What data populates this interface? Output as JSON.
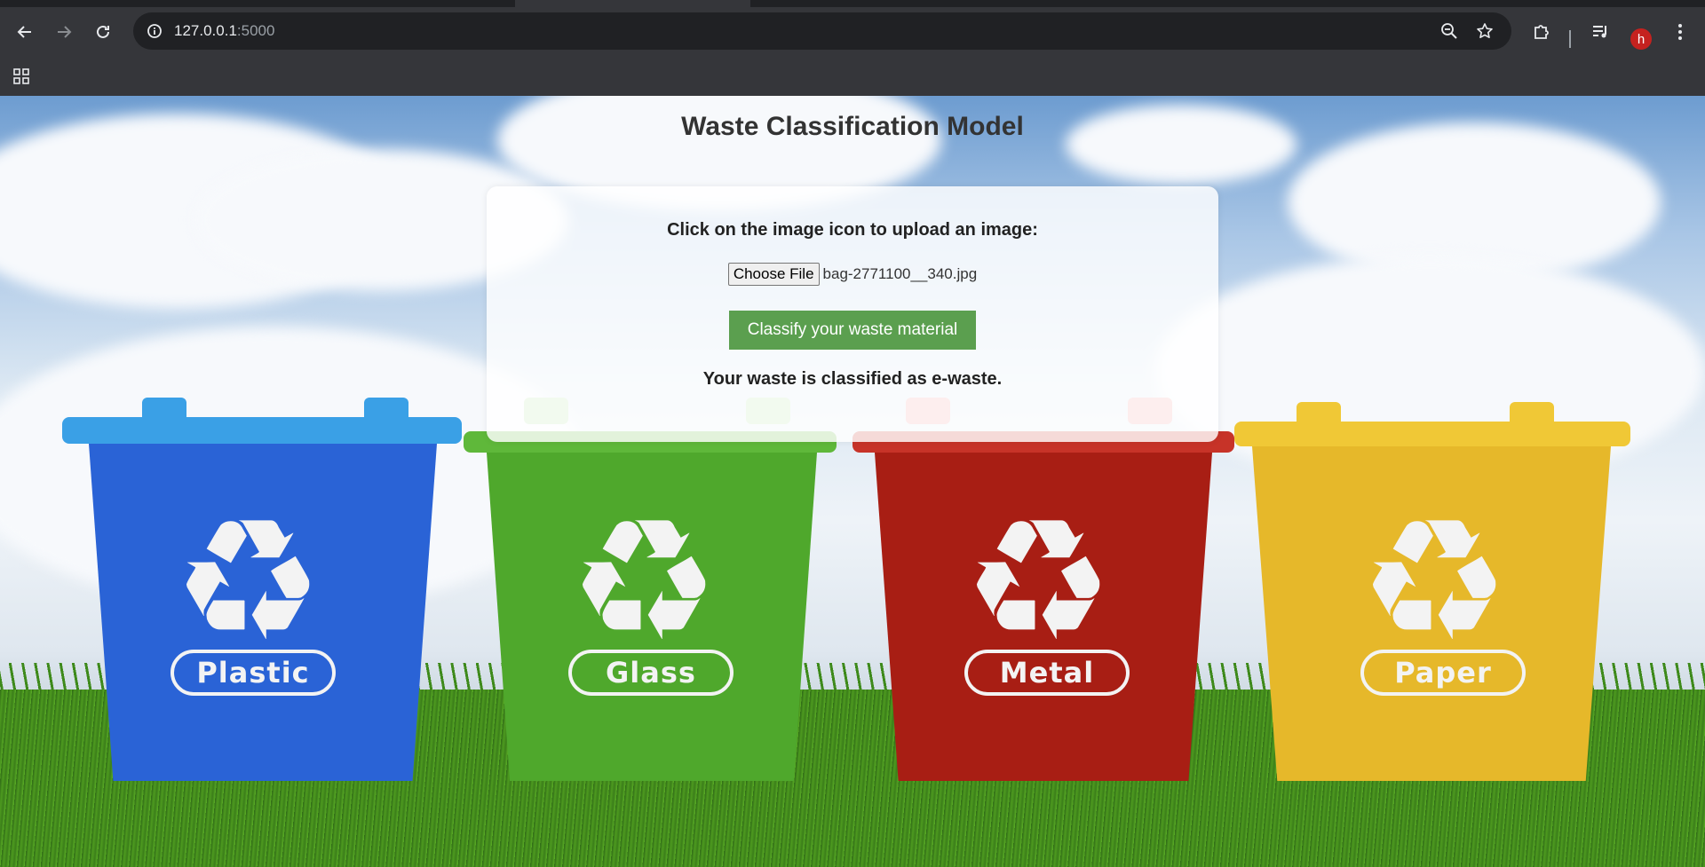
{
  "browser": {
    "url_host": "127.0.0.1",
    "url_port": ":5000",
    "profile_initial": "h",
    "icons": {
      "back": "back-arrow-icon",
      "forward": "forward-arrow-icon",
      "reload": "reload-icon",
      "site_info": "site-info-icon",
      "zoom": "zoom-icon",
      "bookmark": "star-icon",
      "extensions": "puzzle-icon",
      "media": "media-control-icon",
      "menu": "kebab-menu-icon",
      "apps": "apps-grid-icon"
    }
  },
  "page": {
    "title": "Waste Classification Model",
    "upload_prompt": "Click on the image icon to upload an image:",
    "file_button_label": "Choose File",
    "file_name": "bag-2771100__340.jpg",
    "classify_button_label": "Classify your waste material",
    "result_text": "Your waste is classified as e-waste."
  },
  "background": {
    "bins": [
      {
        "label": "Plastic",
        "color": "#2a63d6",
        "lid_color": "#3aa0e6"
      },
      {
        "label": "Glass",
        "color": "#4fa82c",
        "lid_color": "#5fb83a"
      },
      {
        "label": "Metal",
        "color": "#a81e14",
        "lid_color": "#c73328"
      },
      {
        "label": "Paper",
        "color": "#e6b82a",
        "lid_color": "#f0c836"
      }
    ]
  },
  "colors": {
    "classify_button": "#5b9f4f",
    "chrome_dark": "#202124",
    "chrome_toolbar": "#35363a",
    "avatar": "#c5221f"
  }
}
